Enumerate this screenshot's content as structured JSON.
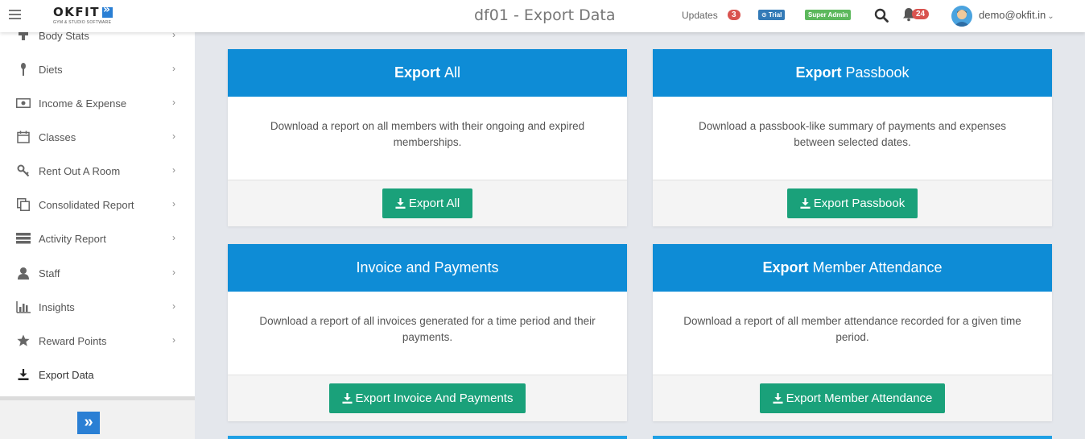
{
  "header": {
    "page_title": "df01 - Export Data",
    "updates_label": "Updates",
    "updates_count": "3",
    "trial_label": "⊙ Trial",
    "admin_label": "Super Admin",
    "notifications_count": "24",
    "user_email": "demo@okfit.in",
    "logo_text": "OKFIT",
    "logo_sub": "GYM & STUDIO SOFTWARE"
  },
  "sidebar": {
    "items": [
      {
        "label": "Body Stats",
        "icon": "body-stats-icon"
      },
      {
        "label": "Diets",
        "icon": "diet-icon"
      },
      {
        "label": "Income & Expense",
        "icon": "money-icon"
      },
      {
        "label": "Classes",
        "icon": "calendar-icon"
      },
      {
        "label": "Rent Out A Room",
        "icon": "key-icon"
      },
      {
        "label": "Consolidated Report",
        "icon": "copy-icon"
      },
      {
        "label": "Activity Report",
        "icon": "server-icon"
      },
      {
        "label": "Staff",
        "icon": "user-icon"
      },
      {
        "label": "Insights",
        "icon": "bar-chart-icon"
      },
      {
        "label": "Reward Points",
        "icon": "star-icon"
      },
      {
        "label": "Export Data",
        "icon": "download-icon"
      }
    ]
  },
  "cards": [
    {
      "title_bold": "Export",
      "title_rest": "All",
      "description": "Download a report on all members with their ongoing and expired memberships.",
      "button": "Export All"
    },
    {
      "title_bold": "Export",
      "title_rest": "Passbook",
      "description": "Download a passbook-like summary of payments and expenses between selected dates.",
      "button": "Export Passbook"
    },
    {
      "title_bold": "",
      "title_rest": "Invoice and Payments",
      "description": "Download a report of all invoices generated for a time period and their payments.",
      "button": "Export Invoice And Payments"
    },
    {
      "title_bold": "Export",
      "title_rest": "Member Attendance",
      "description": "Download a report of all member attendance recorded for a given time period.",
      "button": "Export Member Attendance"
    }
  ],
  "colors": {
    "card_header": "#0e8cd6",
    "button": "#1aa17a",
    "badge_red": "#d9534f",
    "trial_blue": "#337ab7",
    "admin_green": "#5cb85c"
  }
}
